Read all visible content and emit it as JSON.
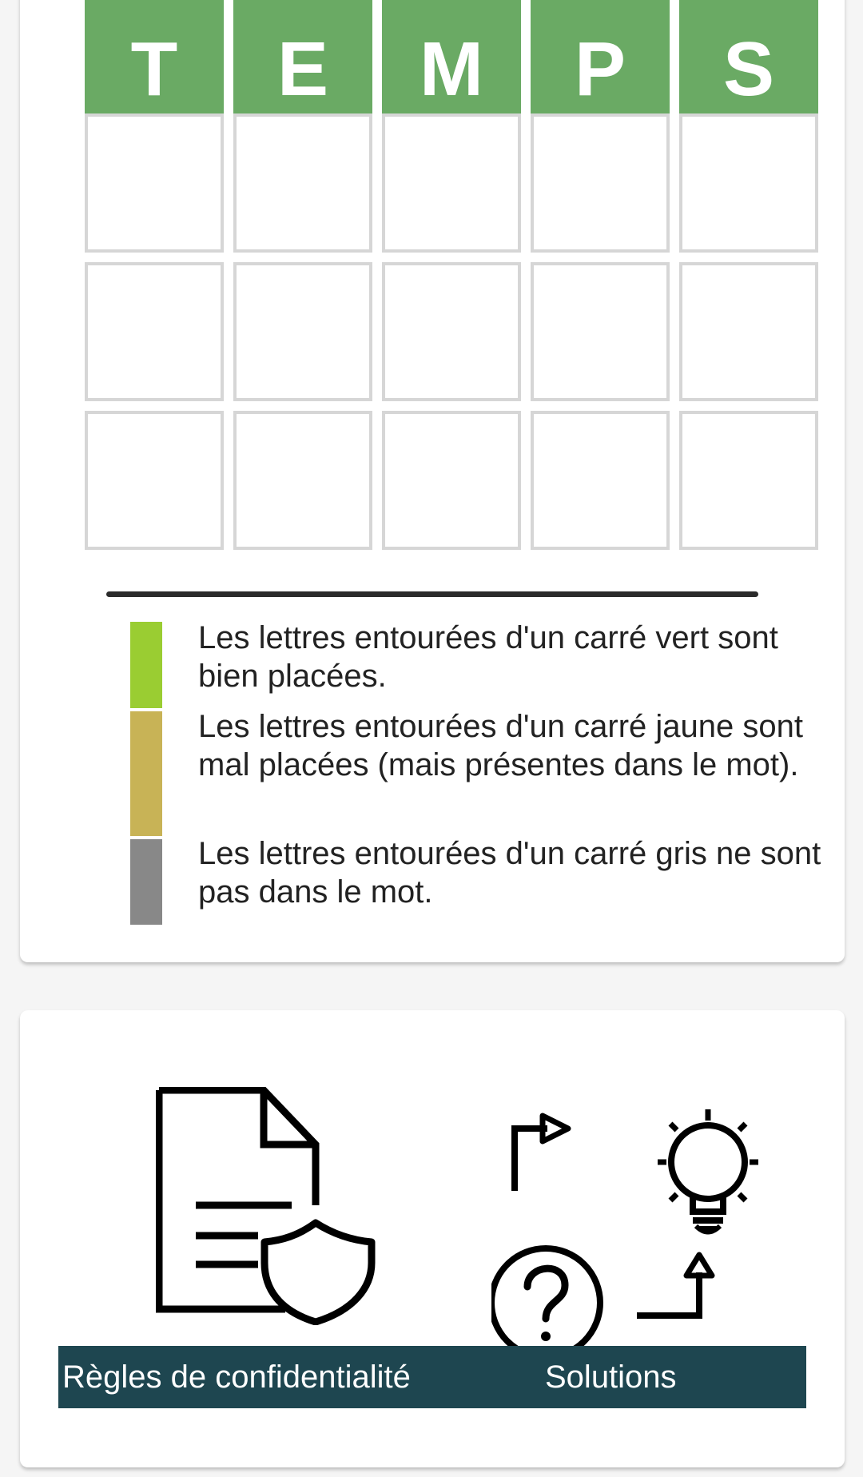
{
  "board": {
    "revealed_word": [
      "T",
      "E",
      "M",
      "P",
      "S"
    ],
    "empty_rows": 3,
    "colors": {
      "correct": "#6aaa64",
      "empty_border": "#d6d6d6"
    }
  },
  "legend": {
    "items": [
      {
        "color": "#9acd32",
        "text": "Les lettres entourées d'un carré vert sont bien placées."
      },
      {
        "color": "#c8b356",
        "text": "Les lettres entourées d'un carré jaune sont mal placées (mais présentes dans le mot)."
      },
      {
        "color": "#888888",
        "text": "Les lettres entourées d'un carré gris ne sont pas dans le mot."
      }
    ]
  },
  "footer": {
    "privacy_label": "Règles de confidentialité",
    "solutions_label": "Solutions",
    "bar_color": "#1e4650"
  },
  "icons": {
    "privacy": "document-shield-icon",
    "solutions": "solutions-lightbulb-question-icon"
  }
}
